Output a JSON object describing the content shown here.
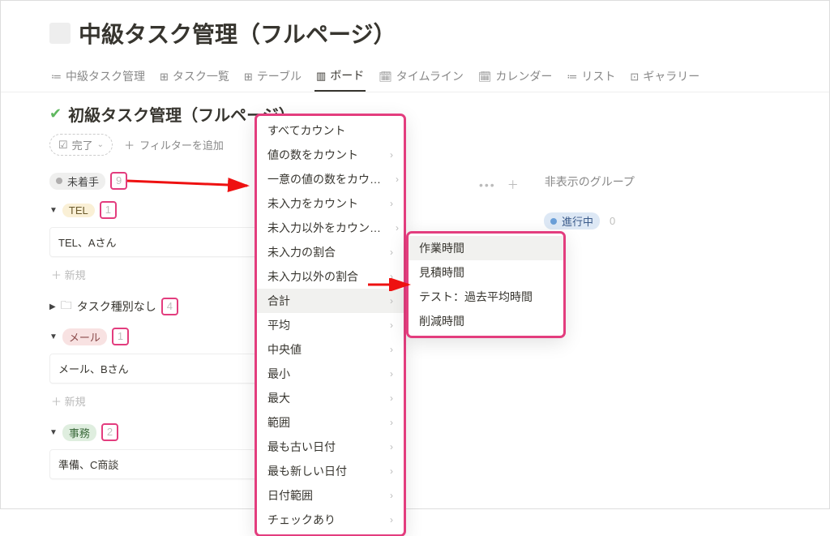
{
  "header": {
    "title": "中級タスク管理（フルページ）"
  },
  "tabs": [
    {
      "icon": "≔",
      "label": "中級タスク管理"
    },
    {
      "icon": "⊞",
      "label": "タスク一覧"
    },
    {
      "icon": "⊞",
      "label": "テーブル"
    },
    {
      "icon": "▥",
      "label": "ボード",
      "active": true
    },
    {
      "icon": "🗓",
      "label": "タイムライン"
    },
    {
      "icon": "🗓",
      "label": "カレンダー"
    },
    {
      "icon": "≔",
      "label": "リスト"
    },
    {
      "icon": "⊡",
      "label": "ギャラリー"
    }
  ],
  "subheader": {
    "icon": "✔",
    "title": "初級タスク管理（フルページ）"
  },
  "filters": {
    "chip_label": "完了",
    "add_label": "フィルターを追加"
  },
  "groups": {
    "top": {
      "label": "未着手",
      "count": "9"
    },
    "tel": {
      "label": "TEL",
      "count": "1",
      "card": "TEL、Aさん",
      "add": "新規"
    },
    "no_type": {
      "label": "タスク種別なし",
      "count": "4"
    },
    "mail": {
      "label": "メール",
      "count": "1",
      "card": "メール、Bさん",
      "add": "新規"
    },
    "clerical": {
      "label": "事務",
      "count": "2",
      "card": "準備、C商談"
    }
  },
  "right": {
    "hidden_groups": "非表示のグループ",
    "inprogress_label": "進行中",
    "inprogress_count": "0"
  },
  "menu1": [
    {
      "label": "すべてカウント",
      "caret": false
    },
    {
      "label": "値の数をカウント",
      "caret": true
    },
    {
      "label": "一意の値の数をカウ…",
      "caret": true
    },
    {
      "label": "未入力をカウント",
      "caret": true
    },
    {
      "label": "未入力以外をカウン…",
      "caret": true
    },
    {
      "label": "未入力の割合",
      "caret": true
    },
    {
      "label": "未入力以外の割合",
      "caret": true
    },
    {
      "label": "合計",
      "caret": true,
      "sel": true
    },
    {
      "label": "平均",
      "caret": true
    },
    {
      "label": "中央値",
      "caret": true
    },
    {
      "label": "最小",
      "caret": true
    },
    {
      "label": "最大",
      "caret": true
    },
    {
      "label": "範囲",
      "caret": true
    },
    {
      "label": "最も古い日付",
      "caret": true
    },
    {
      "label": "最も新しい日付",
      "caret": true
    },
    {
      "label": "日付範囲",
      "caret": true
    },
    {
      "label": "チェックあり",
      "caret": true
    }
  ],
  "menu2": [
    {
      "label": "作業時間",
      "sel": true
    },
    {
      "label": "見積時間"
    },
    {
      "label": "テスト：過去平均時間"
    },
    {
      "label": "削減時間"
    }
  ]
}
